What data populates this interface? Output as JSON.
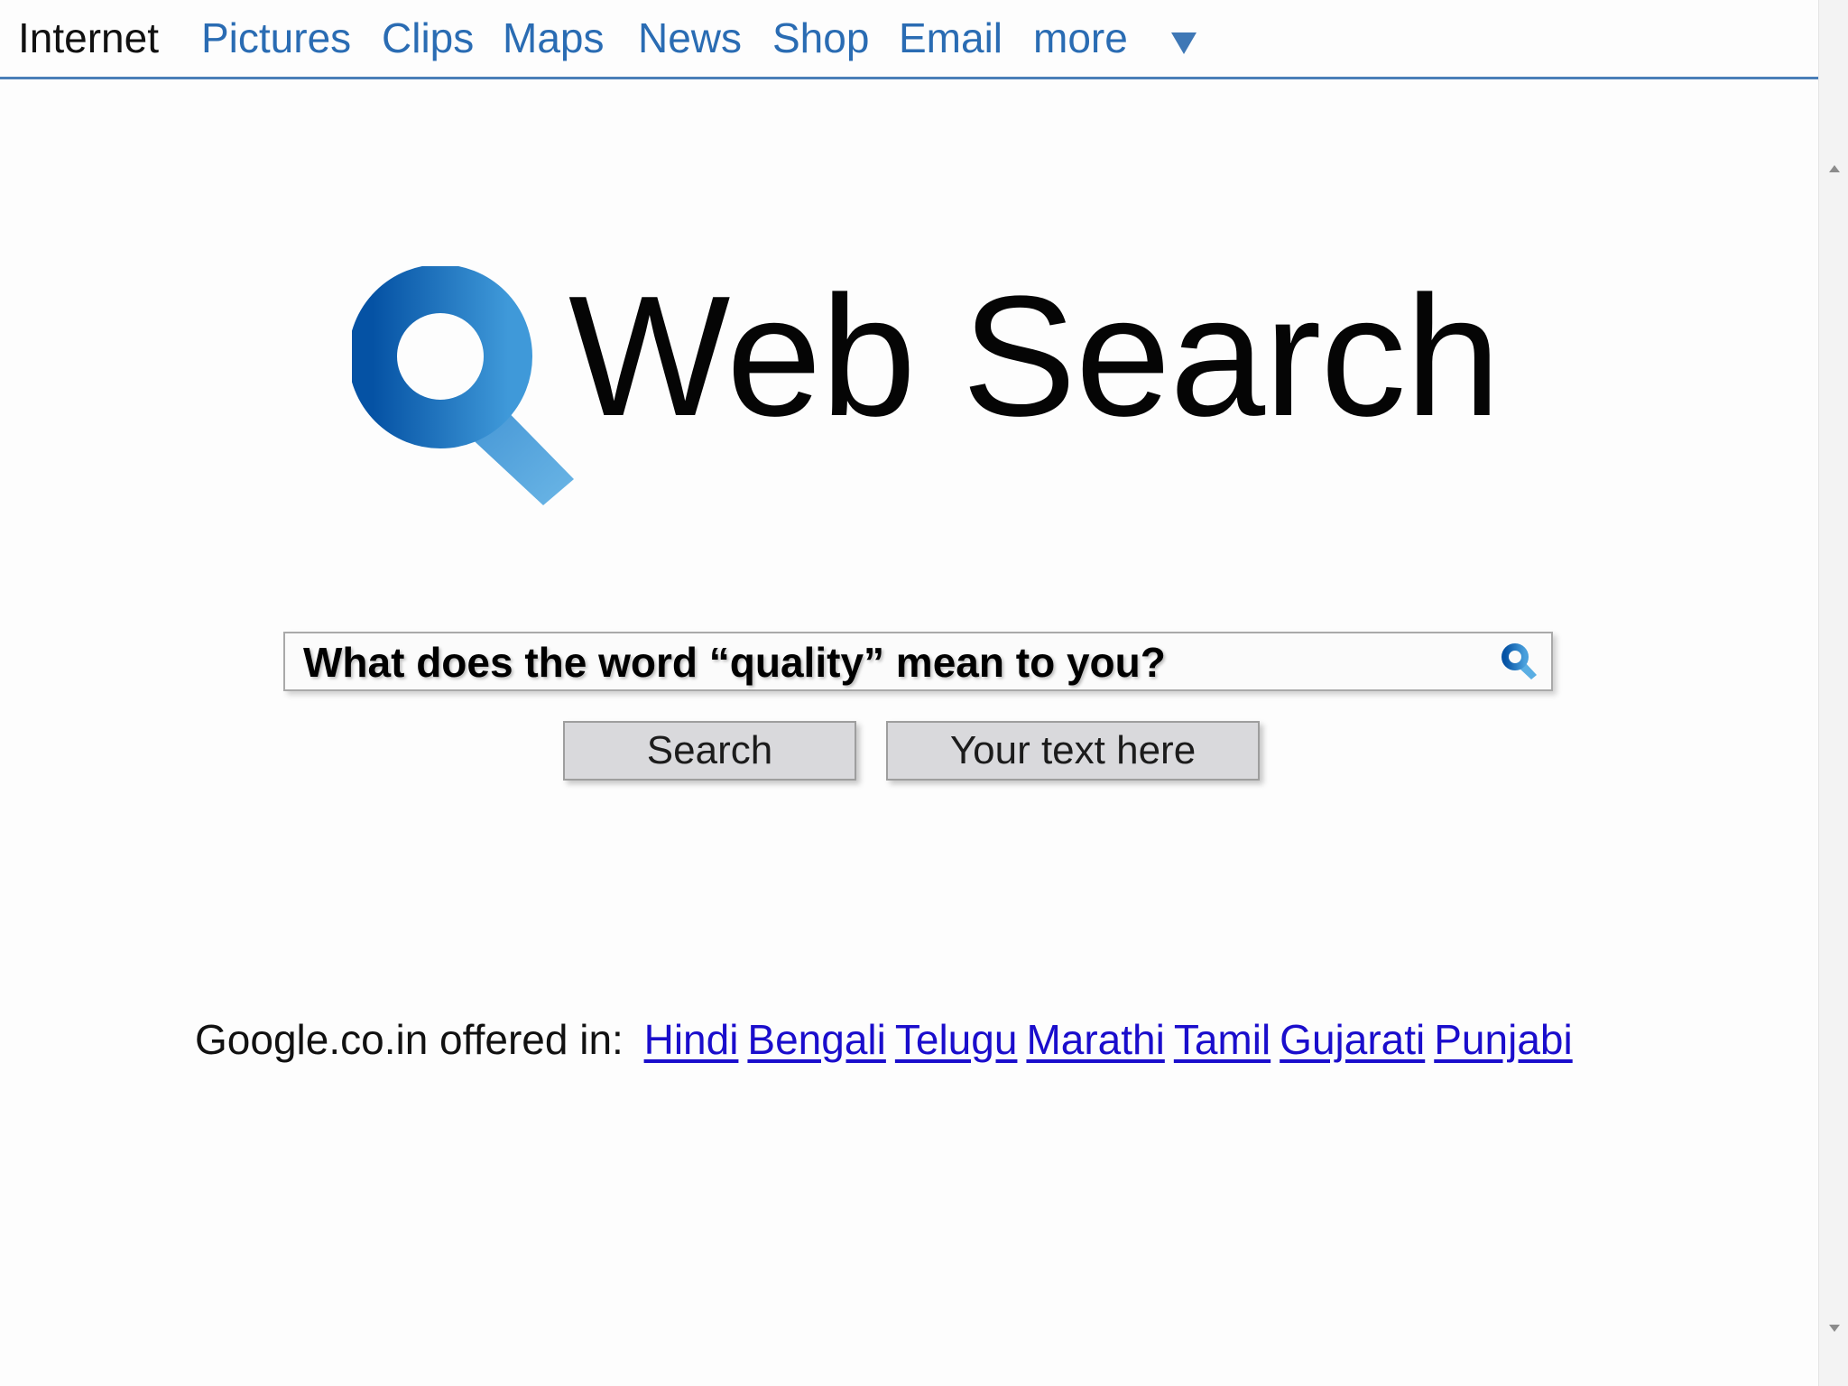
{
  "nav": {
    "items": [
      {
        "label": "Internet",
        "active": true
      },
      {
        "label": "Pictures"
      },
      {
        "label": "Clips"
      },
      {
        "label": "Maps"
      },
      {
        "label": "News"
      },
      {
        "label": "Shop"
      },
      {
        "label": "Email"
      },
      {
        "label": "more"
      }
    ],
    "dropdown_icon": "triangle-down-icon"
  },
  "logo": {
    "icon": "magnifier-icon",
    "text": "Web Search",
    "accent_color": "#0a63b0"
  },
  "search": {
    "query": "What does the word “quality” mean to you?",
    "icon": "search-icon"
  },
  "buttons": {
    "search_label": "Search",
    "custom_label": "Your text here"
  },
  "languages": {
    "prefix": "Google.co.in offered in:",
    "links": [
      "Hindi",
      "Bengali",
      "Telugu",
      "Marathi",
      "Tamil",
      "Gujarati",
      "Punjabi"
    ],
    "link_color": "#1a0dcc"
  }
}
